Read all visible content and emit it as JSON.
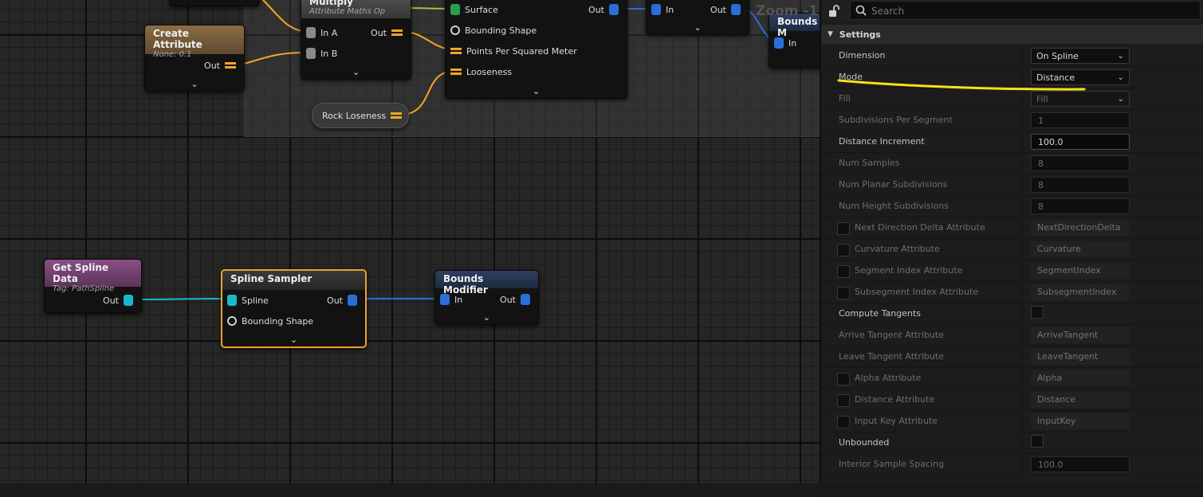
{
  "graph": {
    "zoom_label": "Zoom -1",
    "nodes": {
      "top_partial_a": {},
      "create_attribute": {
        "title": "Create Attribute",
        "subtitle": "None: 0.1",
        "out": "Out"
      },
      "multiply": {
        "title": "Multiply",
        "subtitle": "Attribute Maths Op",
        "in_a": "In A",
        "in_b": "In B",
        "out": "Out"
      },
      "surface_sampler": {
        "surface": "Surface",
        "out": "Out",
        "bounding_shape": "Bounding Shape",
        "points_per_sqm": "Points Per Squared Meter",
        "looseness": "Looseness"
      },
      "top_bounds_modifier": {
        "in": "In",
        "out": "Out"
      },
      "bounds_partial": {
        "title": "Bounds M",
        "in": "In"
      },
      "rock_loseness": {
        "label": "Rock Loseness"
      },
      "get_spline_data": {
        "title": "Get Spline Data",
        "subtitle": "Tag: PathSpline",
        "out": "Out"
      },
      "spline_sampler": {
        "title": "Spline Sampler",
        "spline": "Spline",
        "out": "Out",
        "bounding_shape": "Bounding Shape"
      },
      "bounds_modifier": {
        "title": "Bounds Modifier",
        "in": "In",
        "out": "Out"
      }
    },
    "chevron": "⌄"
  },
  "details": {
    "search_placeholder": "Search",
    "section_title": "Settings",
    "rows": {
      "dimension": {
        "label": "Dimension",
        "value": "On Spline"
      },
      "mode": {
        "label": "Mode",
        "value": "Distance"
      },
      "fill": {
        "label": "Fill",
        "value": "Fill"
      },
      "subdivisions_per_segment": {
        "label": "Subdivisions Per Segment",
        "value": "1"
      },
      "distance_increment": {
        "label": "Distance Increment",
        "value": "100.0"
      },
      "num_samples": {
        "label": "Num Samples",
        "value": "8"
      },
      "num_planar_subdivisions": {
        "label": "Num Planar Subdivisions",
        "value": "8"
      },
      "num_height_subdivisions": {
        "label": "Num Height Subdivisions",
        "value": "8"
      },
      "next_direction_delta_attribute": {
        "label": "Next Direction Delta Attribute",
        "value": "NextDirectionDelta"
      },
      "curvature_attribute": {
        "label": "Curvature Attribute",
        "value": "Curvature"
      },
      "segment_index_attribute": {
        "label": "Segment Index Attribute",
        "value": "SegmentIndex"
      },
      "subsegment_index_attribute": {
        "label": "Subsegment Index Attribute",
        "value": "SubsegmentIndex"
      },
      "compute_tangents": {
        "label": "Compute Tangents"
      },
      "arrive_tangent_attribute": {
        "label": "Arrive Tangent Attribute",
        "value": "ArriveTangent"
      },
      "leave_tangent_attribute": {
        "label": "Leave Tangent Attribute",
        "value": "LeaveTangent"
      },
      "alpha_attribute": {
        "label": "Alpha Attribute",
        "value": "Alpha"
      },
      "distance_attribute": {
        "label": "Distance Attribute",
        "value": "Distance"
      },
      "input_key_attribute": {
        "label": "Input Key Attribute",
        "value": "InputKey"
      },
      "unbounded": {
        "label": "Unbounded"
      },
      "interior_sample_spacing": {
        "label": "Interior Sample Spacing",
        "value": "100.0"
      }
    },
    "dropdown_arrow": "⌄"
  },
  "colors": {
    "accent_selected": "#f0a030",
    "annotation": "#f5e11a",
    "wire_spline": "#1bb8c8",
    "wire_bounds": "#2a6ed8",
    "wire_float": "#f5a623"
  }
}
